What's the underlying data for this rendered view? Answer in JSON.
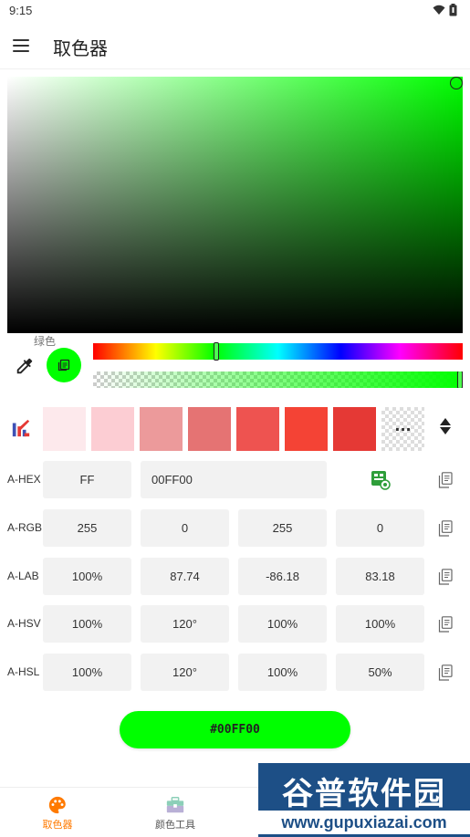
{
  "status_bar": {
    "time": "9:15"
  },
  "app_bar": {
    "title": "取色器"
  },
  "picker": {
    "color_name": "绿色",
    "current_color": "#00ff00",
    "hue_degrees": 120,
    "alpha": 1.0
  },
  "palette": {
    "swatches": [
      "#fde9ec",
      "#fccdd3",
      "#ec9a9b",
      "#e57373",
      "#ee5350",
      "#f44335",
      "#e53935"
    ],
    "more_label": "···"
  },
  "rows": {
    "hex": {
      "label": "A-HEX",
      "alpha": "FF",
      "value": "00FF00"
    },
    "rgb": {
      "label": "A-RGB",
      "values": [
        "255",
        "0",
        "255",
        "0"
      ]
    },
    "lab": {
      "label": "A-LAB",
      "values": [
        "100%",
        "87.74",
        "-86.18",
        "83.18"
      ]
    },
    "hsv": {
      "label": "A-HSV",
      "values": [
        "100%",
        "120°",
        "100%",
        "100%"
      ]
    },
    "hsl": {
      "label": "A-HSL",
      "values": [
        "100%",
        "120°",
        "100%",
        "50%"
      ]
    }
  },
  "hex_button": {
    "label": "#00FF00"
  },
  "bottom_nav": {
    "items": [
      {
        "label": "取色器",
        "icon": "palette-icon",
        "active": true
      },
      {
        "label": "颜色工具",
        "icon": "toolbox-icon",
        "active": false
      }
    ]
  },
  "colors": {
    "accent": "#ff7a00",
    "selected": "#00ff00"
  },
  "watermark": {
    "title": "谷普软件园",
    "url": "www.gupuxiazai.com"
  }
}
